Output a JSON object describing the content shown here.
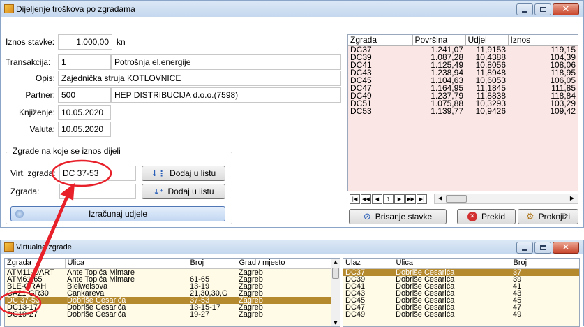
{
  "main_window": {
    "title": "Dijeljenje troškova po zgradama",
    "iznos_label": "Iznos stavke:",
    "iznos_value": "1.000,00",
    "iznos_unit": "kn",
    "transakcija_label": "Transakcija:",
    "transakcija_id": "1",
    "transakcija_name": "Potrošnja el.energije",
    "opis_label": "Opis:",
    "opis_value": "Zajednička struja KOTLOVNICE",
    "partner_label": "Partner:",
    "partner_id": "500",
    "partner_name": "HEP DISTRIBUCIJA d.o.o.(7598)",
    "knjizenje_label": "Knjiženje:",
    "knjizenje_value": "10.05.2020",
    "valuta_label": "Valuta:",
    "valuta_value": "10.05.2020",
    "group_title": "Zgrade na koje se iznos dijeli",
    "virt_zgrada_label": "Virt. zgrada:",
    "virt_zgrada_value": "DC 37-53",
    "zgrada_label": "Zgrada:",
    "zgrada_value": "",
    "dodaj_label": "Dodaj u listu",
    "izracunaj_label": "Izračunaj udjele",
    "brisanje_label": "Brisanje stavke",
    "prekid_label": "Prekid",
    "proknjizi_label": "Proknjiži"
  },
  "share_grid": {
    "columns": [
      "Zgrada",
      "Površina",
      "Udjel",
      "Iznos"
    ],
    "rows": [
      [
        "DC37",
        "1.241,07",
        "11,9153",
        "119,15"
      ],
      [
        "DC39",
        "1.087,28",
        "10,4388",
        "104,39"
      ],
      [
        "DC41",
        "1.125,49",
        "10,8056",
        "108,06"
      ],
      [
        "DC43",
        "1.238,94",
        "11,8948",
        "118,95"
      ],
      [
        "DC45",
        "1.104,63",
        "10,6053",
        "106,05"
      ],
      [
        "DC47",
        "1.164,95",
        "11,1845",
        "111,85"
      ],
      [
        "DC49",
        "1.237,79",
        "11,8838",
        "118,84"
      ],
      [
        "DC51",
        "1.075,88",
        "10,3293",
        "103,29"
      ],
      [
        "DC53",
        "1.139,77",
        "10,9426",
        "109,42"
      ]
    ]
  },
  "virt_window": {
    "title": "Virtualne zgrade",
    "left_columns": [
      "Zgrada",
      "Ulica",
      "Broj",
      "Grad / mjesto"
    ],
    "left_rows": [
      [
        "ATM11-OART",
        "Ante Topića Mimare",
        "",
        "Zagreb"
      ],
      [
        "ATM61-65",
        "Ante Topića Mimare",
        "61-65",
        "Zagreb"
      ],
      [
        "BLE-GRAH",
        "Bleiweisova",
        "13-19",
        "Zagreb"
      ],
      [
        "CA21-GR30",
        "Cankareva",
        "21,30,30,G",
        "Zagreb"
      ],
      [
        "DC 37-53",
        "Dobriše Cesarića",
        "37-53",
        "Zagreb"
      ],
      [
        "DC13-17",
        "Dobriše Cesarića",
        "13-15-17",
        "Zagreb"
      ],
      [
        "DC19-27",
        "Dobriše Cesarića",
        "19-27",
        "Zagreb"
      ]
    ],
    "left_selected_index": 4,
    "right_columns": [
      "Ulaz",
      "Ulica",
      "Broj"
    ],
    "right_rows": [
      [
        "DC37",
        "Dobriše Cesarića",
        "37"
      ],
      [
        "DC39",
        "Dobriše Cesarića",
        "39"
      ],
      [
        "DC41",
        "Dobriše Cesarića",
        "41"
      ],
      [
        "DC43",
        "Dobriše Cesarića",
        "43"
      ],
      [
        "DC45",
        "Dobriše Cesarića",
        "45"
      ],
      [
        "DC47",
        "Dobriše Cesarića",
        "47"
      ],
      [
        "DC49",
        "Dobriše Cesarića",
        "49"
      ]
    ],
    "right_selected_index": 0
  },
  "colors": {
    "annotation": "#e8202a",
    "selection": "#b58a2f",
    "grid_bg": "#fbe6e6"
  }
}
